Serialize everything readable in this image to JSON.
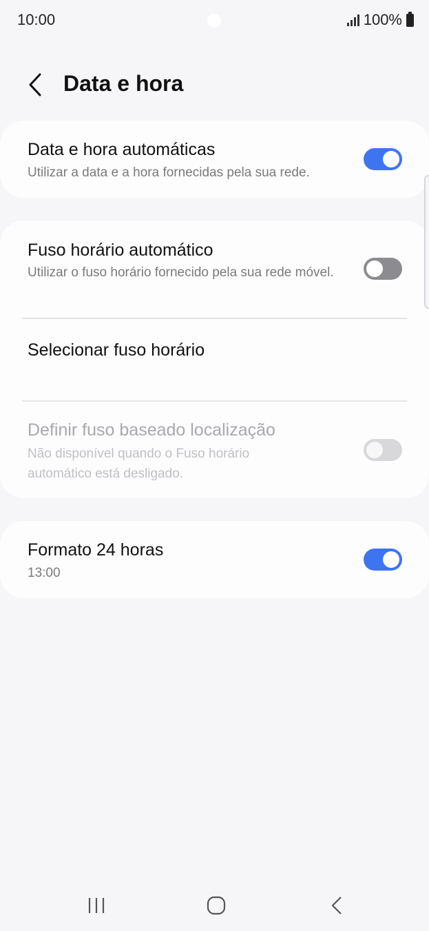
{
  "status_bar": {
    "time": "10:00",
    "battery_percent": "100%",
    "icons": [
      "camera-cutout",
      "signal-icon",
      "battery-icon"
    ]
  },
  "header": {
    "title": "Data e hora",
    "back_icon": "chevron-left-icon"
  },
  "settings": {
    "auto_datetime": {
      "title": "Data e hora automáticas",
      "subtitle": "Utilizar a data e a hora fornecidas pela sua rede.",
      "toggle": "on"
    },
    "auto_timezone": {
      "title": "Fuso horário automático",
      "subtitle": "Utilizar o fuso horário fornecido pela sua rede móvel.",
      "toggle": "off"
    },
    "select_timezone": {
      "title": "Selecionar fuso horário"
    },
    "location_timezone": {
      "title": "Definir fuso baseado localização",
      "subtitle": "Não disponível quando o Fuso horário automático está desligado.",
      "toggle": "off",
      "enabled": false
    },
    "format_24h": {
      "title": "Formato 24 horas",
      "subtitle": "13:00",
      "toggle": "on"
    }
  },
  "nav_bar": {
    "buttons": [
      "recent-apps-icon",
      "home-icon",
      "back-icon"
    ]
  },
  "colors": {
    "background": "#f6f6f8",
    "card": "#fdfdfe",
    "accent": "#3e74f0",
    "toggle_off": "#8c8c90",
    "toggle_disabled": "#d8d8db"
  }
}
